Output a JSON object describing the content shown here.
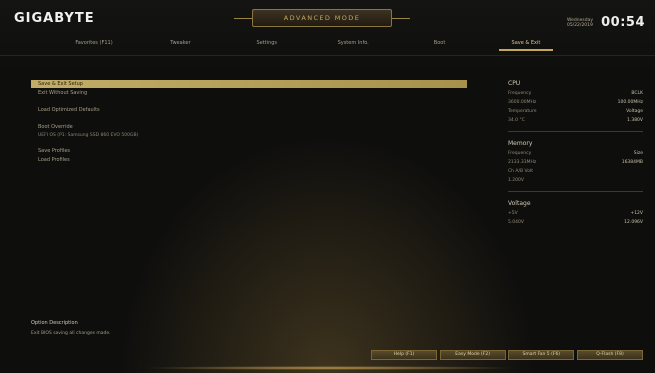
{
  "header": {
    "logo": "GIGABYTE",
    "mode": "ADVANCED MODE",
    "date_line1": "Wednesday",
    "date_line2": "05/22/2019",
    "time": "00:54"
  },
  "tabs": [
    {
      "label": "Favorites (F11)",
      "active": false
    },
    {
      "label": "Tweaker",
      "active": false
    },
    {
      "label": "Settings",
      "active": false
    },
    {
      "label": "System Info.",
      "active": false
    },
    {
      "label": "Boot",
      "active": false
    },
    {
      "label": "Save & Exit",
      "active": true
    }
  ],
  "menu": {
    "items": [
      {
        "label": "Save & Exit Setup",
        "selected": true
      },
      {
        "label": "Exit Without Saving",
        "selected": false
      },
      {
        "label": "Load Optimized Defaults",
        "selected": false
      },
      {
        "label": "Boot Override",
        "selected": false
      }
    ],
    "boot_override_sub": "UEFI OS (P1: Samsung SSD 860 EVO 500GB)",
    "profiles": [
      {
        "label": "Save Profiles"
      },
      {
        "label": "Load Profiles"
      }
    ]
  },
  "panel": {
    "cpu": {
      "title": "CPU",
      "rows": [
        {
          "k": "Frequency",
          "v": "BCLK"
        },
        {
          "k": "3600.00MHz",
          "v": "100.00MHz"
        },
        {
          "k": "Temperature",
          "v": "Voltage"
        },
        {
          "k": "34.0 °C",
          "v": "1.380V"
        }
      ]
    },
    "memory": {
      "title": "Memory",
      "rows": [
        {
          "k": "Frequency",
          "v": "Size"
        },
        {
          "k": "2133.33MHz",
          "v": "16384MB"
        },
        {
          "k": "Ch A/B Volt",
          "v": ""
        },
        {
          "k": "1.200V",
          "v": ""
        }
      ]
    },
    "voltage": {
      "title": "Voltage",
      "rows": [
        {
          "k": "+5V",
          "v": "+12V"
        },
        {
          "k": "5.040V",
          "v": "12.096V"
        }
      ]
    }
  },
  "help": {
    "title": "Option Description",
    "text": "Exit BIOS saving all changes made."
  },
  "bottom_buttons": [
    {
      "label": "Help (F1)"
    },
    {
      "label": "Easy Mode (F2)"
    },
    {
      "label": "Smart Fan 5 (F6)"
    },
    {
      "label": "Q-Flash (F8)"
    }
  ]
}
